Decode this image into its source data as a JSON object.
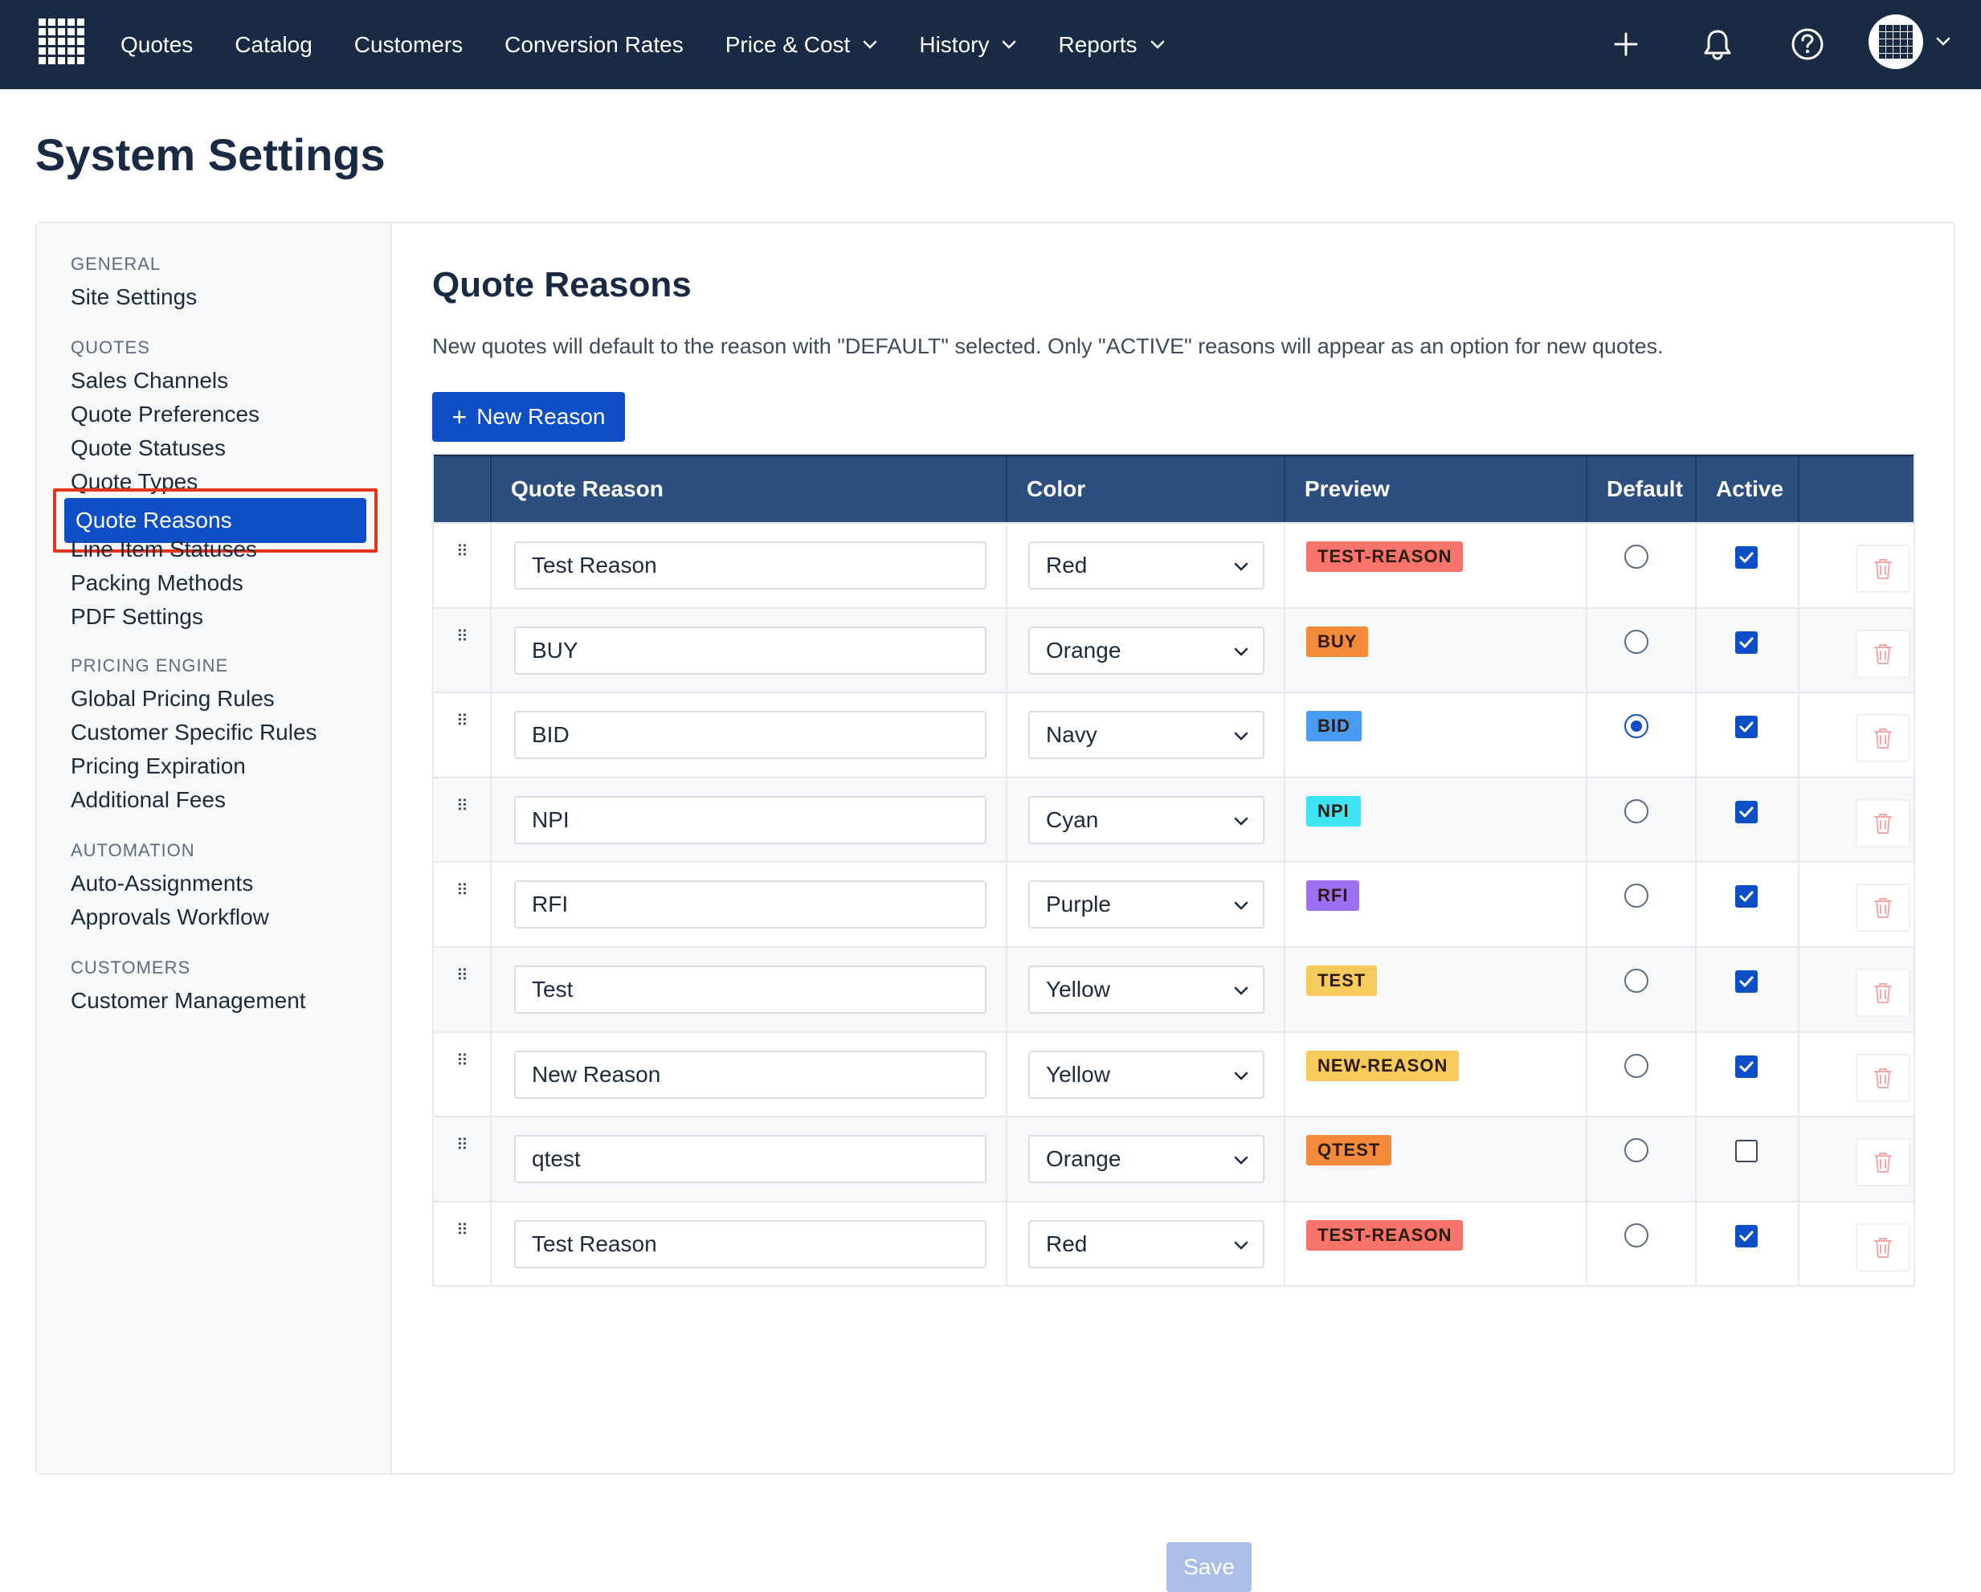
{
  "nav": {
    "items": [
      {
        "label": "Quotes",
        "dropdown": false
      },
      {
        "label": "Catalog",
        "dropdown": false
      },
      {
        "label": "Customers",
        "dropdown": false
      },
      {
        "label": "Conversion Rates",
        "dropdown": false
      },
      {
        "label": "Price & Cost",
        "dropdown": true
      },
      {
        "label": "History",
        "dropdown": true
      },
      {
        "label": "Reports",
        "dropdown": true
      }
    ],
    "icons": [
      "plus-icon",
      "bell-icon",
      "help-icon",
      "avatar"
    ]
  },
  "page": {
    "title": "System Settings"
  },
  "sidebar": {
    "sections": [
      {
        "title": "GENERAL",
        "items": [
          "Site Settings"
        ]
      },
      {
        "title": "QUOTES",
        "items": [
          "Sales Channels",
          "Quote Preferences",
          "Quote Statuses",
          "Quote Types",
          "Quote Reasons",
          "Line Item Statuses",
          "Packing Methods",
          "PDF Settings"
        ]
      },
      {
        "title": "PRICING ENGINE",
        "items": [
          "Global Pricing Rules",
          "Customer Specific Rules",
          "Pricing Expiration",
          "Additional Fees"
        ]
      },
      {
        "title": "AUTOMATION",
        "items": [
          "Auto-Assignments",
          "Approvals Workflow"
        ]
      },
      {
        "title": "CUSTOMERS",
        "items": [
          "Customer Management"
        ]
      }
    ],
    "active": "Quote Reasons"
  },
  "main": {
    "title": "Quote Reasons",
    "description": "New quotes will default to the reason with \"DEFAULT\" selected. Only \"ACTIVE\" reasons will appear as an option for new quotes.",
    "new_button": "New Reason",
    "save_button": "Save",
    "columns": [
      "",
      "Quote Reason",
      "Color",
      "Preview",
      "Default",
      "Active",
      ""
    ],
    "rows": [
      {
        "reason": "Test Reason",
        "color": "Red",
        "preview": "TEST-REASON",
        "badge_color": "#f8746b",
        "default": false,
        "active": true
      },
      {
        "reason": "BUY",
        "color": "Orange",
        "preview": "BUY",
        "badge_color": "#f48a3a",
        "default": false,
        "active": true
      },
      {
        "reason": "BID",
        "color": "Navy",
        "preview": "BID",
        "badge_color": "#4a9bf2",
        "default": true,
        "active": true
      },
      {
        "reason": "NPI",
        "color": "Cyan",
        "preview": "NPI",
        "badge_color": "#3de4f4",
        "default": false,
        "active": true
      },
      {
        "reason": "RFI",
        "color": "Purple",
        "preview": "RFI",
        "badge_color": "#9c6ff3",
        "default": false,
        "active": true
      },
      {
        "reason": "Test",
        "color": "Yellow",
        "preview": "TEST",
        "badge_color": "#f7ca5c",
        "default": false,
        "active": true
      },
      {
        "reason": "New Reason",
        "color": "Yellow",
        "preview": "NEW-REASON",
        "badge_color": "#f7ca5c",
        "default": false,
        "active": true
      },
      {
        "reason": "qtest",
        "color": "Orange",
        "preview": "QTEST",
        "badge_color": "#f48a3a",
        "default": false,
        "active": false
      },
      {
        "reason": "Test Reason",
        "color": "Red",
        "preview": "TEST-REASON",
        "badge_color": "#f8746b",
        "default": false,
        "active": true
      }
    ]
  }
}
